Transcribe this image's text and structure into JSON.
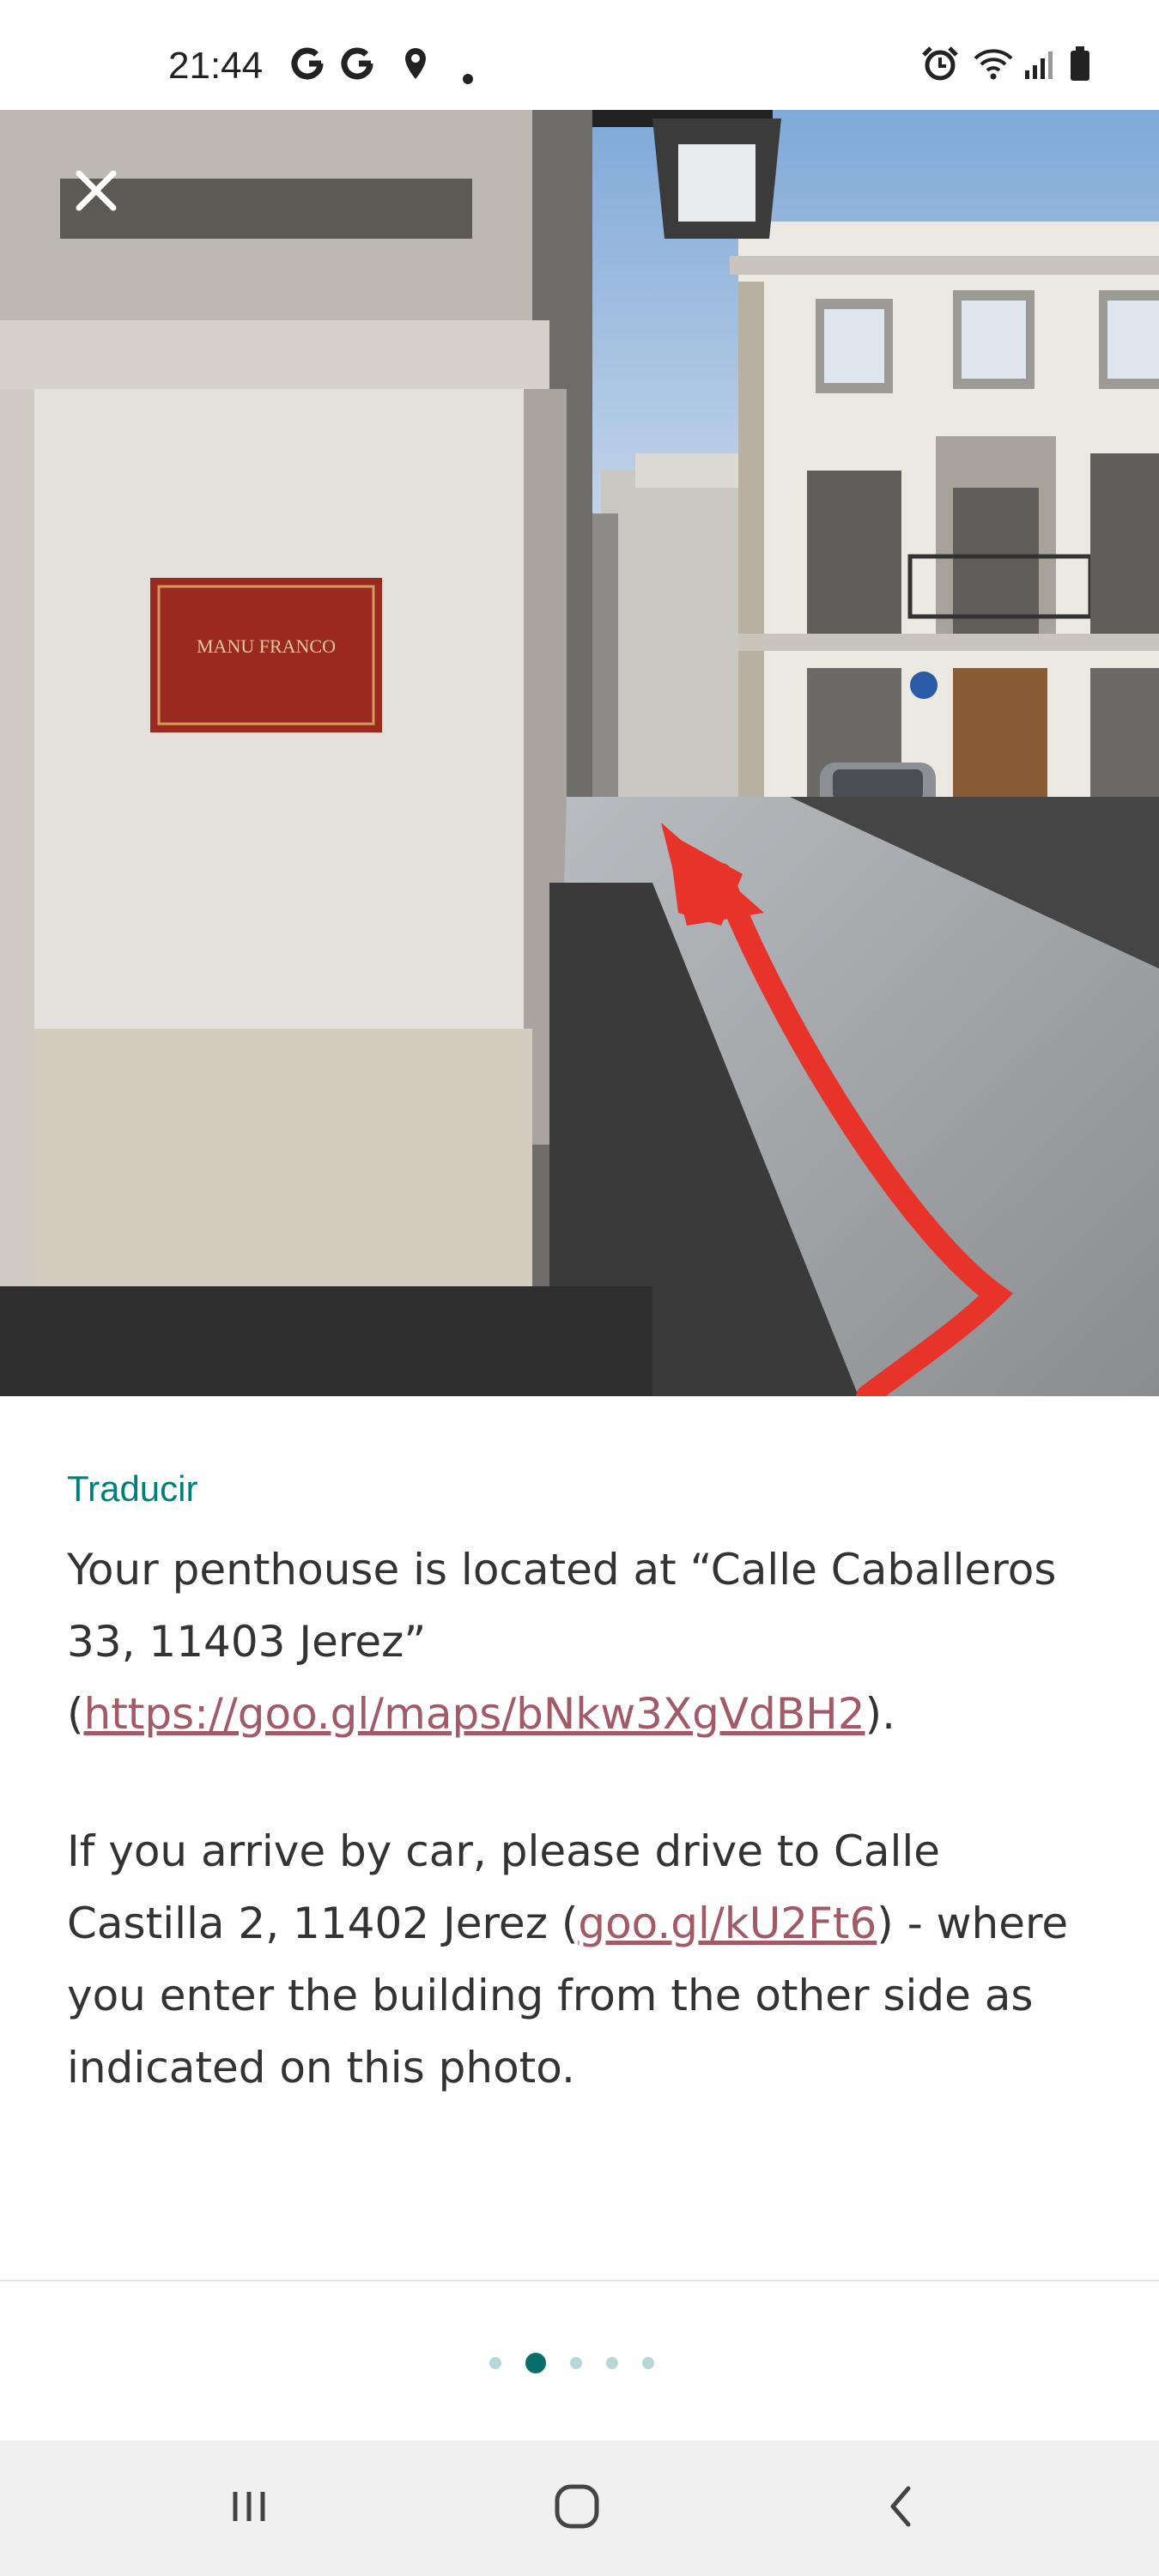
{
  "status_bar": {
    "time": "21:44",
    "left_icons": [
      "google-icon",
      "google-icon",
      "location-icon",
      "dot-icon"
    ],
    "right_icons": [
      "alarm-icon",
      "wifi-icon",
      "signal-icon",
      "battery-icon"
    ]
  },
  "photo": {
    "alt_description": "",
    "sign_text": "MANU FRANCO",
    "annotation_color": "#e8332b"
  },
  "content": {
    "translate_label": "Traducir",
    "para1_text_a": "Your penthouse is located at “Calle Caballeros 33, 11403 Jerez” (",
    "para1_link": "https://goo.gl/maps/bNkw3XgVdBH2",
    "para1_text_b": ").",
    "para2_text_a": "If you arrive by car, please drive to Calle Castilla 2, 11402 Jerez (",
    "para2_link": "goo.gl/kU2Ft6",
    "para2_text_b": ") - where you enter the building from the other side as indicated on this photo.",
    "link_color": "#a25a66",
    "accent_color": "#00807a"
  },
  "pagination": {
    "total": 5,
    "current": 2
  },
  "nav_bar": {
    "buttons": [
      "recent-apps-icon",
      "home-icon",
      "back-icon"
    ]
  }
}
